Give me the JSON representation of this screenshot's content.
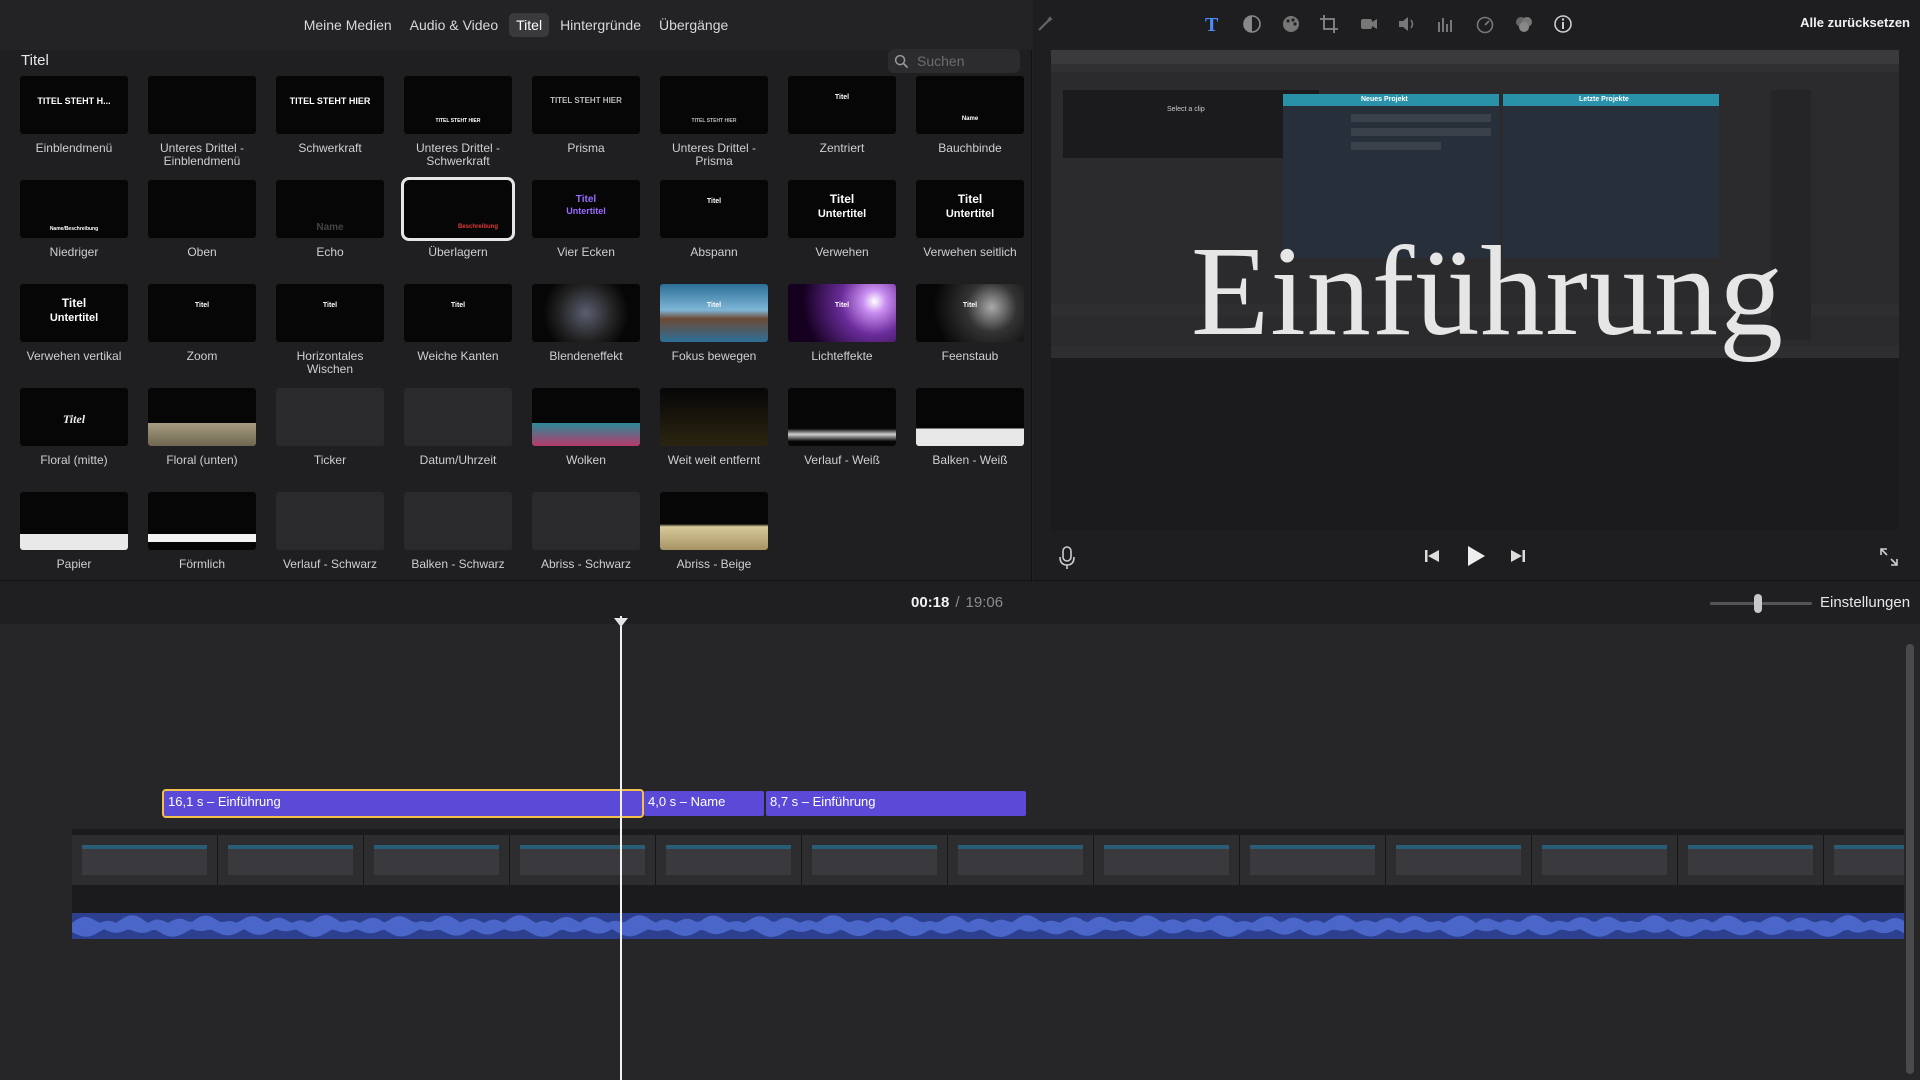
{
  "browser": {
    "tabs": [
      {
        "label": "Meine Medien",
        "active": false
      },
      {
        "label": "Audio & Video",
        "active": false
      },
      {
        "label": "Titel",
        "active": true
      },
      {
        "label": "Hintergründe",
        "active": false
      },
      {
        "label": "Übergänge",
        "active": false
      }
    ],
    "section_title": "Titel",
    "search_placeholder": "Suchen",
    "titles": [
      "Einblendmenü",
      "Unteres Drittel - Einblendmenü",
      "Schwerkraft",
      "Unteres Drittel - Schwerkraft",
      "Prisma",
      "Unteres Drittel - Prisma",
      "Zentriert",
      "Bauchbinde",
      "Niedriger",
      "Oben",
      "Echo",
      "Überlagern",
      "Vier Ecken",
      "Abspann",
      "Verwehen",
      "Verwehen seitlich",
      "Verwehen vertikal",
      "Zoom",
      "Horizontales Wischen",
      "Weiche Kanten",
      "Blendeneffekt",
      "Fokus bewegen",
      "Lichteffekte",
      "Feenstaub",
      "Floral (mitte)",
      "Floral (unten)",
      "Ticker",
      "Datum/Uhrzeit",
      "Wolken",
      "Weit weit entfernt",
      "Verlauf - Weiß",
      "Balken - Weiß",
      "Papier",
      "Förmlich",
      "Verlauf - Schwarz",
      "Balken - Schwarz",
      "Abriss - Schwarz",
      "Abriss - Beige"
    ],
    "selected_title": "Überlagern",
    "thumb_text": {
      "einblend": "TITEL STEHT H...",
      "schwerkraft": "TITEL STEHT HIER",
      "unteres_schwerkraft": "TITEL STEHT HIER",
      "prisma": "TITEL STEHT HIER",
      "unteres_prisma": "TITEL STEHT HIER",
      "titel": "Titel",
      "untertitel": "Untertitel",
      "name": "Name",
      "beschreibung": "Beschreibung"
    }
  },
  "viewer": {
    "reset_all": "Alle zurücksetzen",
    "preview_title": "Einführung",
    "inner_ui": {
      "new_project": "Neues Projekt",
      "recent_projects": "Letzte Projekte",
      "select_clip": "Select a clip"
    }
  },
  "timeline": {
    "current_time": "00:18",
    "total_time": "19:06",
    "settings_label": "Einstellungen",
    "title_clips": [
      {
        "label": "16,1 s – Einführung",
        "selected": true
      },
      {
        "label": "4,0 s – Name",
        "selected": false
      },
      {
        "label": "8,7 s – Einführung",
        "selected": false
      }
    ]
  },
  "colors": {
    "title_clip": "#5b49d8",
    "selection": "#f2c14b",
    "audio": "#2d3f8f"
  }
}
